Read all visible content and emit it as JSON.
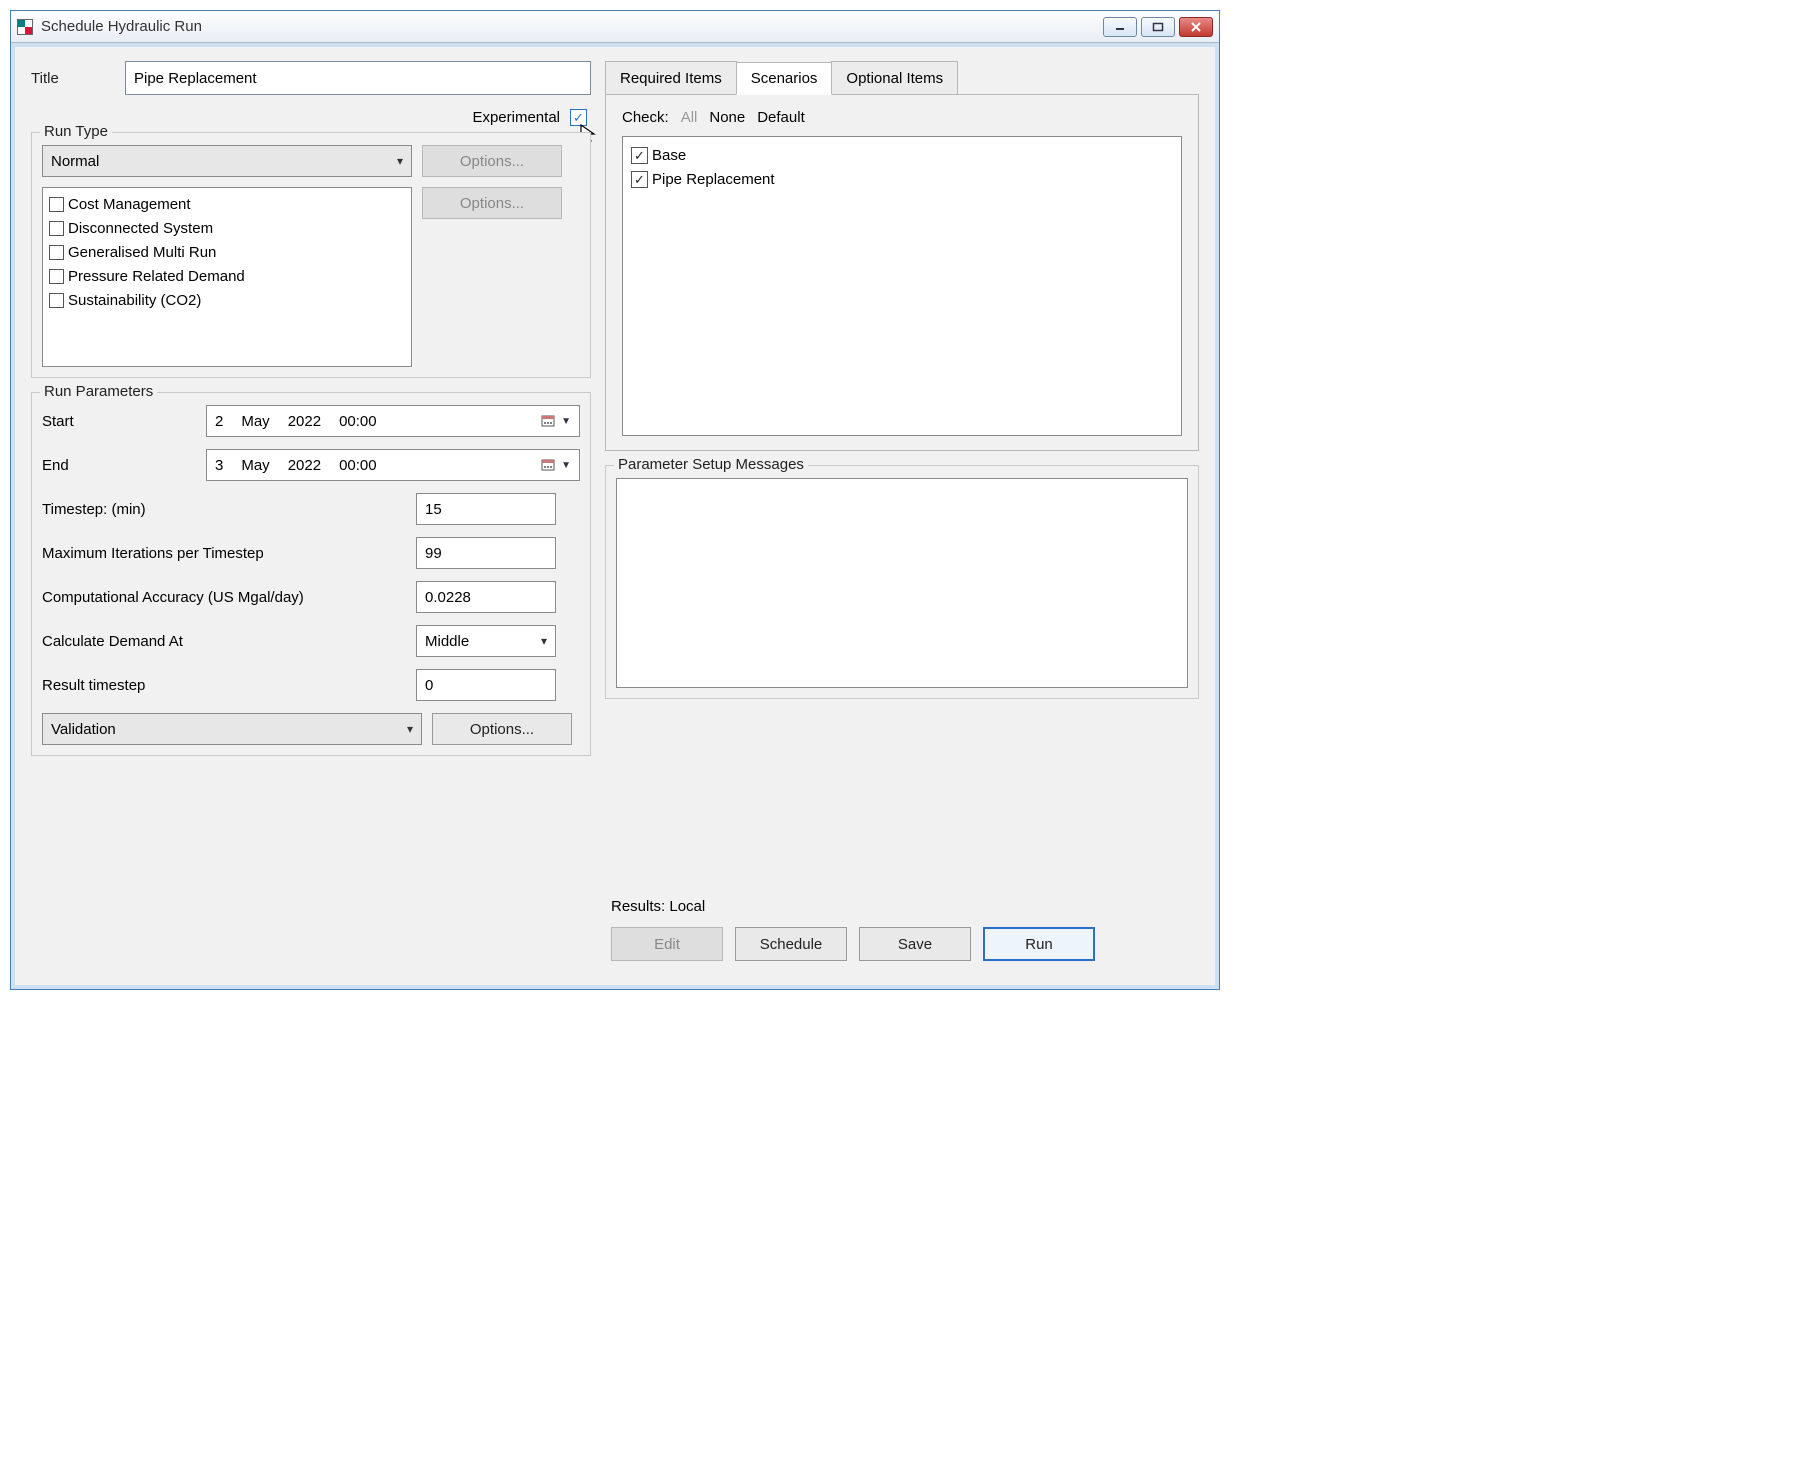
{
  "window": {
    "title": "Schedule Hydraulic Run"
  },
  "left": {
    "title_label": "Title",
    "title_value": "Pipe Replacement",
    "experimental_label": "Experimental",
    "experimental_checked": true,
    "runtype": {
      "legend": "Run Type",
      "selected": "Normal",
      "options_btn1": "Options...",
      "options_btn2": "Options...",
      "items": [
        "Cost Management",
        "Disconnected System",
        "Generalised Multi Run",
        "Pressure Related Demand",
        "Sustainability (CO2)"
      ]
    },
    "params": {
      "legend": "Run Parameters",
      "start_label": "Start",
      "start": {
        "day": "2",
        "mon": "May",
        "year": "2022",
        "time": "00:00"
      },
      "end_label": "End",
      "end": {
        "day": "3",
        "mon": "May",
        "year": "2022",
        "time": "00:00"
      },
      "timestep_label": "Timestep: (min)",
      "timestep_value": "15",
      "maxiter_label": "Maximum Iterations per Timestep",
      "maxiter_value": "99",
      "accuracy_label": "Computational Accuracy (US Mgal/day)",
      "accuracy_value": "0.0228",
      "demand_label": "Calculate Demand At",
      "demand_value": "Middle",
      "result_ts_label": "Result timestep",
      "result_ts_value": "0",
      "validation_value": "Validation",
      "validation_options": "Options..."
    }
  },
  "right": {
    "tabs": {
      "required": "Required Items",
      "scenarios": "Scenarios",
      "optional": "Optional Items"
    },
    "check_label": "Check:",
    "check_all": "All",
    "check_none": "None",
    "check_default": "Default",
    "scenarios": [
      "Base",
      "Pipe Replacement"
    ],
    "messages_legend": "Parameter Setup Messages",
    "results_label": "Results: Local",
    "buttons": {
      "edit": "Edit",
      "schedule": "Schedule",
      "save": "Save",
      "run": "Run"
    }
  }
}
